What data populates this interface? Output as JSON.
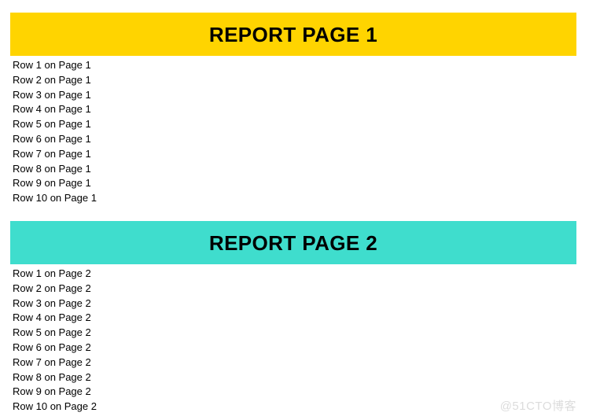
{
  "document": {
    "background_color": "#ffffff"
  },
  "sections": [
    {
      "banner": {
        "title": "REPORT PAGE 1",
        "background_color": "#ffd400",
        "text_color": "#000000"
      },
      "rows": [
        "Row 1 on Page 1",
        "Row 2 on Page 1",
        "Row 3 on Page 1",
        "Row 4 on Page 1",
        "Row 5 on Page 1",
        "Row 6 on Page 1",
        "Row 7 on Page 1",
        "Row 8 on Page 1",
        "Row 9 on Page 1",
        "Row 10 on Page 1"
      ]
    },
    {
      "banner": {
        "title": "REPORT PAGE 2",
        "background_color": "#3fddcd",
        "text_color": "#000000"
      },
      "rows": [
        "Row 1 on Page 2",
        "Row 2 on Page 2",
        "Row 3 on Page 2",
        "Row 4 on Page 2",
        "Row 5 on Page 2",
        "Row 6 on Page 2",
        "Row 7 on Page 2",
        "Row 8 on Page 2",
        "Row 9 on Page 2",
        "Row 10 on Page 2"
      ]
    }
  ],
  "watermark": {
    "text": "@51CTO博客",
    "color": "#dcdcdc"
  }
}
